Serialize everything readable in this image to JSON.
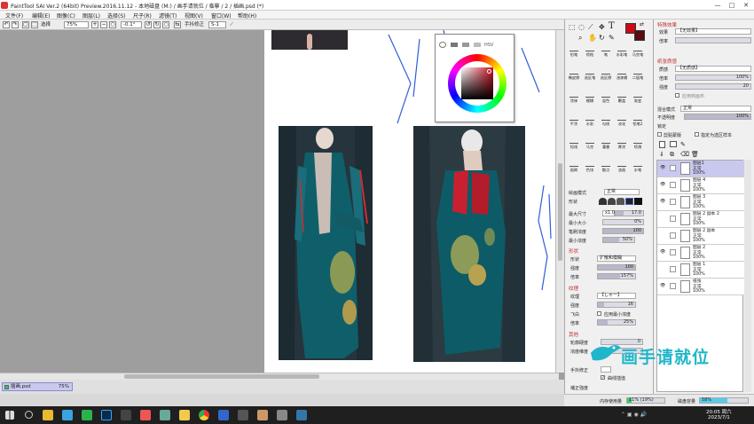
{
  "window": {
    "title": "PaintTool SAI Ver.2 (64bit) Preview.2016.11.12 - 本地磁盘 (M:) / 画手请就位 / 临摹 / 2 / 插画.psd (*)",
    "min": "—",
    "max": "□",
    "close": "✕"
  },
  "menu": [
    "文件(F)",
    "编辑(E)",
    "图像(C)",
    "图层(L)",
    "选择(S)",
    "尺子(R)",
    "滤镜(T)",
    "视图(V)",
    "窗口(W)",
    "帮助(H)"
  ],
  "toolbar": {
    "selection_label": "选择",
    "zoom_value": "75%",
    "rotation_value": "-0.1°",
    "stabilizer_label": "手抖修正",
    "stabilizer_value": "S-1"
  },
  "document": {
    "tab_name": "插画.psd",
    "tab_zoom": "75%"
  },
  "color_popup": {
    "hsv_label": "HSV",
    "accent": "#cc1122"
  },
  "colors": {
    "primary": "#cc0b17",
    "secondary": "#5a0b10",
    "accent_layer": "#c9c9f0"
  },
  "tools": {
    "rows": [
      [
        "铅笔",
        "喷枪",
        "笔",
        "水彩笔",
        "马克笔"
      ],
      [
        "橡皮擦",
        "选区笔",
        "选区擦",
        "油漆桶",
        "二值笔"
      ],
      [
        "涂抹",
        "模糊",
        "混色",
        "覆盖",
        "渐变"
      ],
      [
        "平涂",
        "水彩",
        "勾线",
        "淡化",
        "铅笔2"
      ],
      [
        "短线",
        "马克",
        "灌墨",
        "厚涂",
        "喷溅"
      ],
      [
        "画刷",
        "色块",
        "散点",
        "油画",
        "水笔"
      ]
    ],
    "mode_label": "绘画模式",
    "mode_value": "正常",
    "shape_label": "形状",
    "size_label": "最大尺寸",
    "size_mult": "x1.0",
    "size_value": "17.0",
    "min_size_label": "最小大小",
    "min_size_value": "0%",
    "density_label": "笔刷浓度",
    "density_value": "100",
    "min_density_label": "最小浓度",
    "min_density_value": "50%",
    "shape_section": "形状",
    "shape_type_label": "形状",
    "shape_type_value": "扩散和模糊",
    "shape_strength_label": "强度",
    "shape_strength_value": "100",
    "shape_scale_label": "倍率",
    "shape_scale_value": "157%",
    "texture_section": "纹理",
    "texture_label": "纹理",
    "texture_value": "【しゃー】",
    "texture_strength_label": "强度",
    "texture_strength_value": "16",
    "texture_scale_label": "倍率",
    "texture_scale_value": "25%",
    "blend_label": "飞白",
    "apply_min_density": "应用最小浓度",
    "other_section": "其他",
    "edge_label": "轮廓硬度",
    "edge_value": "0",
    "mix_label": "浓度维度",
    "stabilizer_label": "手抖修正",
    "curve_label": "曲线插值",
    "correct_label": "補正強度"
  },
  "right": {
    "effects_header": "特殊效果",
    "effect_label": "效果",
    "effect_value": "【无效果】",
    "blend_header": "纸张质感",
    "paper_label": "质感",
    "paper_value": "【无质感】",
    "scale_label": "倍率",
    "scale_value": "100%",
    "strength_label": "强度",
    "strength_value": "20",
    "apply_canvas": "应用到画布",
    "blending_label": "混合模式",
    "blending_value": "正常",
    "opacity_label": "不透明度",
    "opacity_value": "100%",
    "protect_label": "锁定",
    "clip_label": "剪贴蒙版",
    "ref_label": "指定为选区样本"
  },
  "layers": [
    {
      "name": "图层1",
      "mode": "正常",
      "opacity": "100%",
      "visible": true,
      "selected": true
    },
    {
      "name": "图层 4",
      "mode": "正常",
      "opacity": "100%",
      "visible": true,
      "selected": false
    },
    {
      "name": "图层 3",
      "mode": "正常",
      "opacity": "100%",
      "visible": true,
      "selected": false
    },
    {
      "name": "图层 2 副本 2",
      "mode": "正常",
      "opacity": "100%",
      "visible": false,
      "selected": false
    },
    {
      "name": "图层 2 副本",
      "mode": "正常",
      "opacity": "100%",
      "visible": false,
      "selected": false
    },
    {
      "name": "图层 2",
      "mode": "正常",
      "opacity": "100%",
      "visible": true,
      "selected": false
    },
    {
      "name": "图层 1",
      "mode": "正常",
      "opacity": "100%",
      "visible": false,
      "selected": false
    },
    {
      "name": "纸张",
      "mode": "正常",
      "opacity": "100%",
      "visible": true,
      "selected": false
    }
  ],
  "status": {
    "memory_label": "内存使用量",
    "memory_value": "11% (19%)",
    "disk_label": "磁盘容量",
    "disk_value": "58%",
    "memory_fraction": 0.11,
    "disk_fraction": 0.58
  },
  "watermark": {
    "text": "画手请就位"
  },
  "taskbar": {
    "time": "20:05 周六",
    "date": "2023/7/1"
  }
}
